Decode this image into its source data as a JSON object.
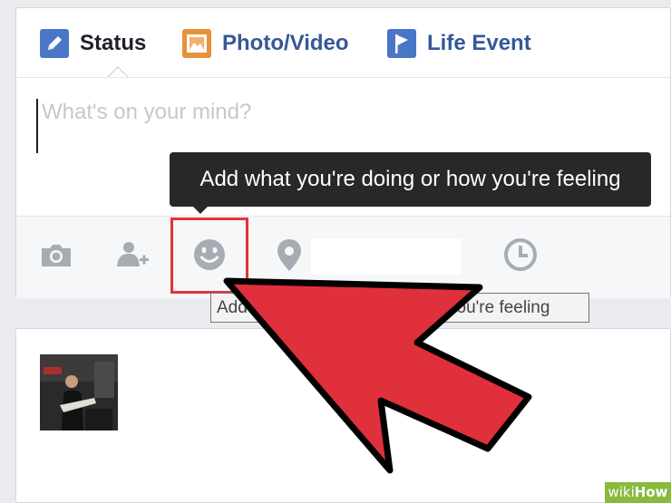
{
  "composer": {
    "tabs": [
      {
        "label": "Status",
        "icon": "pencil-icon",
        "color": "#1d2129"
      },
      {
        "label": "Photo/Video",
        "icon": "photo-icon",
        "color": "#365899"
      },
      {
        "label": "Life Event",
        "icon": "flag-icon",
        "color": "#365899"
      }
    ],
    "placeholder": "What's on your mind?",
    "actions": [
      "camera-icon",
      "tag-friends-icon",
      "feeling-emoji-icon",
      "location-pin-icon",
      "clock-icon"
    ]
  },
  "tooltip": {
    "text": "Add what you're doing or how you're feeling"
  },
  "system_tooltip": {
    "text": "Add what you're doing or how you're feeling"
  },
  "annotation": {
    "highlight_color": "#e53238",
    "arrow_color": "#e0303b"
  },
  "watermark": {
    "prefix": "wiki",
    "suffix": "How"
  }
}
